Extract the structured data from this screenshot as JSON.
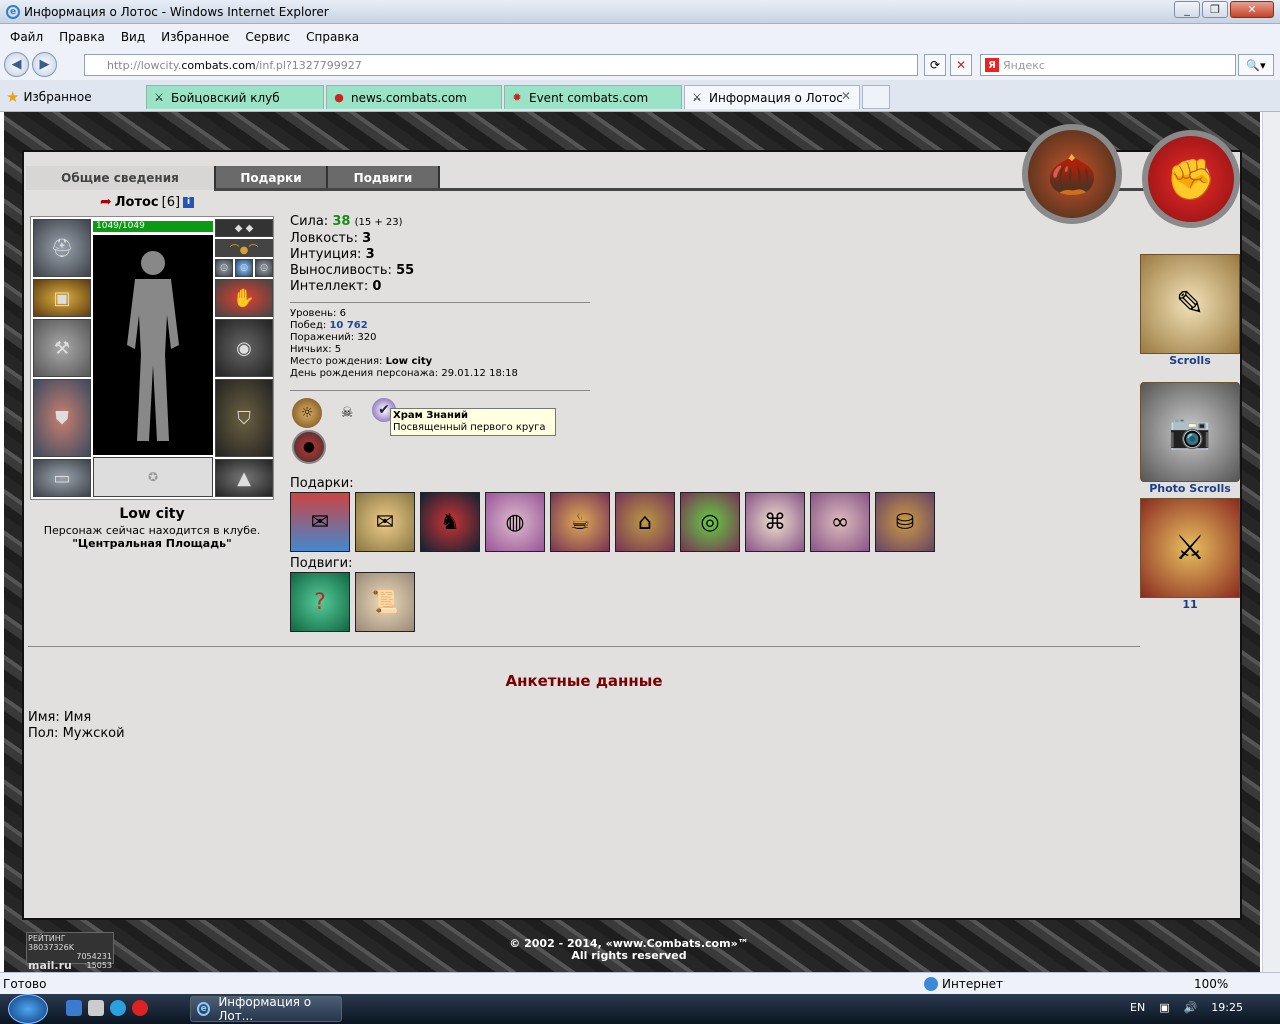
{
  "window": {
    "title": "Информация о Лотос - Windows Internet Explorer"
  },
  "menu": [
    "Файл",
    "Правка",
    "Вид",
    "Избранное",
    "Сервис",
    "Справка"
  ],
  "address": {
    "prefix": "http://lowcity.",
    "host": "combats.com",
    "path": "/inf.pl?1327799927"
  },
  "search": {
    "placeholder": "Яндекс"
  },
  "favorites_label": "Избранное",
  "tabs": [
    {
      "label": "Бойцовский клуб"
    },
    {
      "label": "news.combats.com"
    },
    {
      "label": "Event combats.com"
    },
    {
      "label": "Информация о Лотос"
    }
  ],
  "page_tabs": [
    "Общие сведения",
    "Подарки",
    "Подвиги"
  ],
  "character": {
    "name": "Лотос",
    "level": "[6]",
    "hp": "1049/1049",
    "location": "Low city",
    "location_desc": "Персонаж сейчас находится в клубе.",
    "room": "\"Центральная Площадь\""
  },
  "stats": {
    "strength_label": "Сила:",
    "strength": "38",
    "strength_extra": "(15 + 23)",
    "agility_label": "Ловкость:",
    "agility": "3",
    "intuition_label": "Интуиция:",
    "intuition": "3",
    "stamina_label": "Выносливость:",
    "stamina": "55",
    "intellect_label": "Интеллект:",
    "intellect": "0"
  },
  "details": {
    "level_label": "Уровень:",
    "level": "6",
    "wins_label": "Побед:",
    "wins": "10 762",
    "losses_label": "Поражений:",
    "losses": "320",
    "draws_label": "Ничьих:",
    "draws": "5",
    "birthplace_label": "Место рождения:",
    "birthplace": "Low city",
    "birthday_label": "День рождения персонажа:",
    "birthday": "29.01.12 18:18"
  },
  "tooltip": {
    "title": "Храм Знаний",
    "text": "Посвященный первого круга"
  },
  "gifts_label": "Подарки:",
  "feats_label": "Подвиги:",
  "anket": {
    "title": "Анкетные данные",
    "name_label": "Имя:",
    "name": "Имя",
    "sex_label": "Пол:",
    "sex": "Мужской"
  },
  "side": {
    "scrolls": "Scrolls",
    "photo_scrolls": "Photo Scrolls",
    "count": "11"
  },
  "footer": {
    "copyright": "© 2002 - 2014, «www.Combats.com»™",
    "rights": "All rights reserved",
    "rating": "РЕЙТИНГ",
    "r1": "38037326K",
    "r2": "7054231",
    "r3": "15053",
    "mail": "mail.ru"
  },
  "status": {
    "ready": "Готово",
    "zone": "Интернет",
    "zoom": "100%"
  },
  "taskbar": {
    "task": "Информация о Лот...",
    "lang": "EN",
    "time": "19:25"
  }
}
